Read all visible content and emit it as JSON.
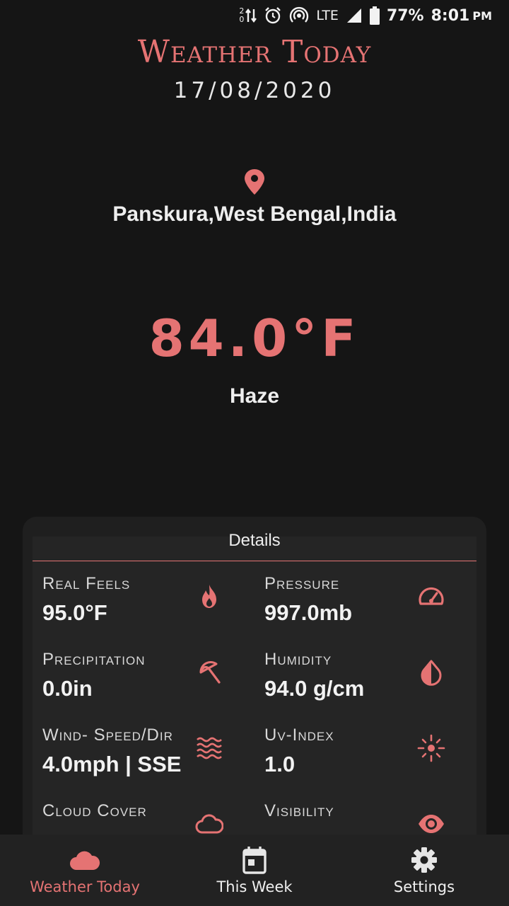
{
  "status_bar": {
    "data_top": "2",
    "data_bottom": "0",
    "network": "LTE",
    "battery_percent": "77%",
    "time": "8:01",
    "ampm": "PM"
  },
  "header": {
    "title": "Weather Today",
    "date": "17/08/2020"
  },
  "location": "Panskura,West Bengal,India",
  "current": {
    "temperature": "84.0°F",
    "condition": "Haze"
  },
  "details": {
    "title": "Details",
    "items": [
      {
        "label": "Real Feels",
        "value": "95.0°F",
        "icon": "flame-icon"
      },
      {
        "label": "Pressure",
        "value": "997.0mb",
        "icon": "gauge-icon"
      },
      {
        "label": "Precipitation",
        "value": "0.0in",
        "icon": "umbrella-icon"
      },
      {
        "label": "Humidity",
        "value": "94.0 g/cm",
        "icon": "drop-icon"
      },
      {
        "label": "Wind- Speed/Dir",
        "value": "4.0mph | SSE",
        "icon": "waves-icon"
      },
      {
        "label": "Uv-Index",
        "value": "1.0",
        "icon": "sun-icon"
      },
      {
        "label": "Cloud Cover",
        "value": "",
        "icon": "cloud-icon"
      },
      {
        "label": "Visibility",
        "value": "",
        "icon": "eye-icon"
      }
    ]
  },
  "nav": {
    "items": [
      {
        "label": "Weather Today",
        "icon": "cloud-icon",
        "active": true
      },
      {
        "label": "This Week",
        "icon": "calendar-icon",
        "active": false
      },
      {
        "label": "Settings",
        "icon": "gear-icon",
        "active": false
      }
    ]
  },
  "colors": {
    "accent": "#e57373",
    "background": "#151515",
    "card": "#252525"
  }
}
